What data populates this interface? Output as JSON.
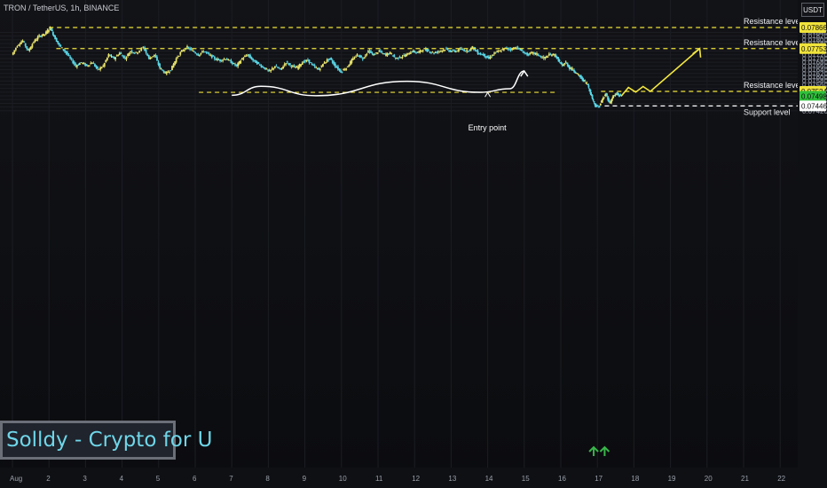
{
  "header": {
    "symbol_info": "TRON / TetherUS, 1h, BINANCE",
    "currency_badge": "USDT"
  },
  "watermark": "Solldy - Crypto for U",
  "colors": {
    "background": "#0e0f12",
    "up_candle": "#e8e36b",
    "down_candle": "#5ad6e6",
    "level_line": "#f0e33a",
    "support_line": "#ffffff",
    "current_price_bg": "#2fbf3b",
    "arrow_green": "#39b54a",
    "projection": "#f2e641",
    "path_white": "#ffffff"
  },
  "chart_data": {
    "type": "candlestick",
    "x_tick_labels": [
      "Aug",
      "2",
      "3",
      "4",
      "5",
      "6",
      "7",
      "8",
      "9",
      "10",
      "11",
      "12",
      "13",
      "14",
      "15",
      "16",
      "17",
      "18",
      "19",
      "20",
      "21",
      "22"
    ],
    "y_tick_labels": [
      "0.07840",
      "0.07820",
      "0.07800",
      "0.07780",
      "0.07760",
      "0.07740",
      "0.07720",
      "0.07700",
      "0.07680",
      "0.07660",
      "0.07640",
      "0.07620",
      "0.07600",
      "0.07580",
      "0.07560",
      "0.07540",
      "0.07520",
      "0.07500",
      "0.07480",
      "0.07460",
      "0.07440",
      "0.07420"
    ],
    "ylim": [
      0.0741,
      0.0788
    ],
    "price_labels": [
      {
        "value": "0.07866",
        "kind": "level"
      },
      {
        "value": "0.07753",
        "kind": "level"
      },
      {
        "value": "0.07524",
        "kind": "level"
      },
      {
        "value": "0.07498",
        "kind": "current"
      },
      {
        "value": "0.07446",
        "kind": "support"
      }
    ],
    "levels": [
      {
        "label": "Resistance level",
        "price": 0.07866,
        "day_from": 2.0,
        "day_to": 22.6
      },
      {
        "label": "Resistance level",
        "price": 0.07753,
        "day_from": 2.2,
        "day_to": 22.6
      },
      {
        "label": "Resistance level",
        "price": 0.07524,
        "day_from": 17.1,
        "day_to": 22.6
      },
      {
        "label": "Support level",
        "price": 0.07446,
        "day_from": 17.2,
        "day_to": 22.6
      }
    ],
    "inner_level": {
      "price": 0.07519,
      "day_from": 6.1,
      "day_to": 15.9
    },
    "annotations": [
      {
        "text": "Entry point",
        "day": 14.0,
        "price": 0.07457
      }
    ],
    "price_path": [
      [
        1.0,
        0.0772
      ],
      [
        1.15,
        0.0777
      ],
      [
        1.3,
        0.07795
      ],
      [
        1.45,
        0.0774
      ],
      [
        1.6,
        0.0779
      ],
      [
        1.75,
        0.0782
      ],
      [
        1.9,
        0.0783
      ],
      [
        2.05,
        0.07866
      ],
      [
        2.15,
        0.0782
      ],
      [
        2.3,
        0.0777
      ],
      [
        2.45,
        0.0774
      ],
      [
        2.6,
        0.077
      ],
      [
        2.75,
        0.0766
      ],
      [
        2.9,
        0.0768
      ],
      [
        3.05,
        0.0766
      ],
      [
        3.2,
        0.0768
      ],
      [
        3.35,
        0.0764
      ],
      [
        3.5,
        0.0766
      ],
      [
        3.65,
        0.0772
      ],
      [
        3.8,
        0.077
      ],
      [
        3.95,
        0.0773
      ],
      [
        4.1,
        0.077
      ],
      [
        4.25,
        0.0774
      ],
      [
        4.4,
        0.0773
      ],
      [
        4.6,
        0.0776
      ],
      [
        4.75,
        0.077
      ],
      [
        4.9,
        0.0772
      ],
      [
        5.05,
        0.0765
      ],
      [
        5.2,
        0.0762
      ],
      [
        5.35,
        0.0764
      ],
      [
        5.5,
        0.077
      ],
      [
        5.65,
        0.0774
      ],
      [
        5.8,
        0.0776
      ],
      [
        5.95,
        0.0774
      ],
      [
        6.1,
        0.0772
      ],
      [
        6.25,
        0.0774
      ],
      [
        6.4,
        0.0772
      ],
      [
        6.55,
        0.077
      ],
      [
        6.7,
        0.0769
      ],
      [
        6.85,
        0.077
      ],
      [
        7.0,
        0.0768
      ],
      [
        7.15,
        0.0766
      ],
      [
        7.3,
        0.077
      ],
      [
        7.45,
        0.0772
      ],
      [
        7.6,
        0.0769
      ],
      [
        7.75,
        0.0767
      ],
      [
        7.9,
        0.0765
      ],
      [
        8.05,
        0.0763
      ],
      [
        8.2,
        0.0766
      ],
      [
        8.35,
        0.0764
      ],
      [
        8.5,
        0.0768
      ],
      [
        8.65,
        0.0766
      ],
      [
        8.8,
        0.0765
      ],
      [
        8.95,
        0.0768
      ],
      [
        9.1,
        0.0769
      ],
      [
        9.25,
        0.0766
      ],
      [
        9.4,
        0.0764
      ],
      [
        9.55,
        0.0768
      ],
      [
        9.7,
        0.077
      ],
      [
        9.85,
        0.0766
      ],
      [
        10.0,
        0.0763
      ],
      [
        10.15,
        0.0765
      ],
      [
        10.3,
        0.0769
      ],
      [
        10.45,
        0.0772
      ],
      [
        10.6,
        0.077
      ],
      [
        10.75,
        0.0774
      ],
      [
        10.9,
        0.0772
      ],
      [
        11.05,
        0.0774
      ],
      [
        11.2,
        0.0772
      ],
      [
        11.35,
        0.0773
      ],
      [
        11.5,
        0.077
      ],
      [
        11.65,
        0.0771
      ],
      [
        11.8,
        0.0772
      ],
      [
        11.95,
        0.0774
      ],
      [
        12.1,
        0.0773
      ],
      [
        12.25,
        0.0775
      ],
      [
        12.4,
        0.0774
      ],
      [
        12.55,
        0.0773
      ],
      [
        12.7,
        0.0774
      ],
      [
        12.85,
        0.0775
      ],
      [
        13.0,
        0.0774
      ],
      [
        13.15,
        0.0774
      ],
      [
        13.3,
        0.0775
      ],
      [
        13.45,
        0.0774
      ],
      [
        13.6,
        0.0776
      ],
      [
        13.75,
        0.0773
      ],
      [
        13.9,
        0.0772
      ],
      [
        14.05,
        0.077
      ],
      [
        14.2,
        0.0773
      ],
      [
        14.35,
        0.0774
      ],
      [
        14.5,
        0.07755
      ],
      [
        14.65,
        0.0775
      ],
      [
        14.8,
        0.0776
      ],
      [
        14.95,
        0.0774
      ],
      [
        15.1,
        0.0772
      ],
      [
        15.25,
        0.0773
      ],
      [
        15.4,
        0.0772
      ],
      [
        15.55,
        0.077
      ],
      [
        15.7,
        0.0772
      ],
      [
        15.85,
        0.0772
      ],
      [
        15.95,
        0.0769
      ],
      [
        16.05,
        0.0766
      ],
      [
        16.15,
        0.0768
      ],
      [
        16.25,
        0.0765
      ],
      [
        16.35,
        0.0764
      ],
      [
        16.45,
        0.0762
      ],
      [
        16.55,
        0.076
      ],
      [
        16.65,
        0.0758
      ],
      [
        16.75,
        0.0756
      ],
      [
        16.85,
        0.075
      ],
      [
        16.95,
        0.0745
      ],
      [
        17.05,
        0.0744
      ],
      [
        17.15,
        0.0748
      ],
      [
        17.25,
        0.0751
      ],
      [
        17.35,
        0.0746
      ],
      [
        17.45,
        0.075
      ],
      [
        17.55,
        0.0751
      ],
      [
        17.65,
        0.07498
      ]
    ],
    "projection_path": [
      [
        17.65,
        0.07498
      ],
      [
        17.85,
        0.07545
      ],
      [
        18.05,
        0.0752
      ],
      [
        18.25,
        0.0755
      ],
      [
        18.45,
        0.07524
      ],
      [
        19.8,
        0.07753
      ]
    ],
    "white_path": [
      [
        7.0,
        0.07503
      ],
      [
        7.8,
        0.07551
      ],
      [
        9.3,
        0.07501
      ],
      [
        11.8,
        0.07578
      ],
      [
        13.8,
        0.07519
      ],
      [
        14.6,
        0.07538
      ],
      [
        15.0,
        0.07633
      ]
    ],
    "up_arrows": [
      {
        "day": 16.9,
        "price": 0.0742
      },
      {
        "day": 17.2,
        "price": 0.0742
      }
    ]
  }
}
